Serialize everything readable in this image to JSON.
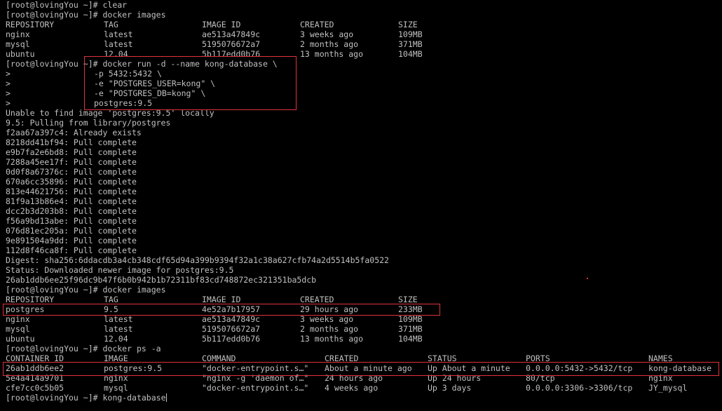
{
  "prompt": "[root@lovingYou ~]# ",
  "cont": ">",
  "block1": {
    "clear_cmd": "clear",
    "images_cmd": "docker images",
    "header": [
      "REPOSITORY",
      "TAG",
      "IMAGE ID",
      "CREATED",
      "SIZE"
    ],
    "rows": [
      [
        "nginx",
        "latest",
        "ae513a47849c",
        "3 weeks ago",
        "109MB"
      ],
      [
        "mysql",
        "latest",
        "5195076672a7",
        "2 months ago",
        "371MB"
      ],
      [
        "ubuntu",
        "12.04",
        "5b117edd0b76",
        "13 months ago",
        "104MB"
      ]
    ]
  },
  "run_cmd": [
    "docker run -d --name kong-database \\",
    "-p 5432:5432 \\",
    "-e \"POSTGRES_USER=kong\" \\",
    "-e \"POSTGRES_DB=kong\" \\",
    "postgres:9.5"
  ],
  "pull": {
    "unable": "Unable to find image 'postgres:9.5' locally",
    "pulling": "9.5: Pulling from library/postgres",
    "layers": [
      "f2aa67a397c4: Already exists",
      "8218dd41bf94: Pull complete",
      "e9b7fa2e6bd8: Pull complete",
      "7288a45ee17f: Pull complete",
      "0d0f8a67376c: Pull complete",
      "670a6cc35896: Pull complete",
      "813e44621756: Pull complete",
      "81f9a13b86e4: Pull complete",
      "dcc2b3d203b8: Pull complete",
      "f56a9bd13abe: Pull complete",
      "076d81ec205a: Pull complete",
      "9e891504a9dd: Pull complete",
      "112d8f46ca8f: Pull complete"
    ],
    "digest": "Digest: sha256:6ddacdb3a4cb348cdf65d94a399b9394f32a1c38a627cfb74a2d5514b5fa0522",
    "status": "Status: Downloaded newer image for postgres:9.5",
    "container_id": "26ab1ddb6ee25f96dc9b47f6b0b942b1b72311bf83cd748872ec321351ba5dcb"
  },
  "block2": {
    "images_cmd": "docker images",
    "header": [
      "REPOSITORY",
      "TAG",
      "IMAGE ID",
      "CREATED",
      "SIZE"
    ],
    "rows": [
      [
        "postgres",
        "9.5",
        "4e52a7b17957",
        "29 hours ago",
        "233MB"
      ],
      [
        "nginx",
        "latest",
        "ae513a47849c",
        "3 weeks ago",
        "109MB"
      ],
      [
        "mysql",
        "latest",
        "5195076672a7",
        "2 months ago",
        "371MB"
      ],
      [
        "ubuntu",
        "12.04",
        "5b117edd0b76",
        "13 months ago",
        "104MB"
      ]
    ]
  },
  "ps": {
    "cmd": "docker ps -a",
    "header": [
      "CONTAINER ID",
      "IMAGE",
      "COMMAND",
      "CREATED",
      "STATUS",
      "PORTS",
      "NAMES"
    ],
    "rows": [
      [
        "26ab1ddb6ee2",
        "postgres:9.5",
        "\"docker-entrypoint.s…\"",
        "About a minute ago",
        "Up About a minute",
        "0.0.0.0:5432->5432/tcp",
        "kong-database"
      ],
      [
        "5e4a414a9701",
        "nginx",
        "\"nginx -g 'daemon of…\"",
        "24 hours ago",
        "Up 24 hours",
        "80/tcp",
        "nginx"
      ],
      [
        "cfe7cc0c5b05",
        "mysql",
        "\"docker-entrypoint.s…\"",
        "4 weeks ago",
        "Up 3 days",
        "0.0.0.0:3306->3306/tcp",
        "JY_mysql"
      ]
    ]
  },
  "final_input": "kong-database",
  "colors": {
    "background": "#000000",
    "text": "#c0c0c0",
    "highlight_box": "#e0323a"
  }
}
